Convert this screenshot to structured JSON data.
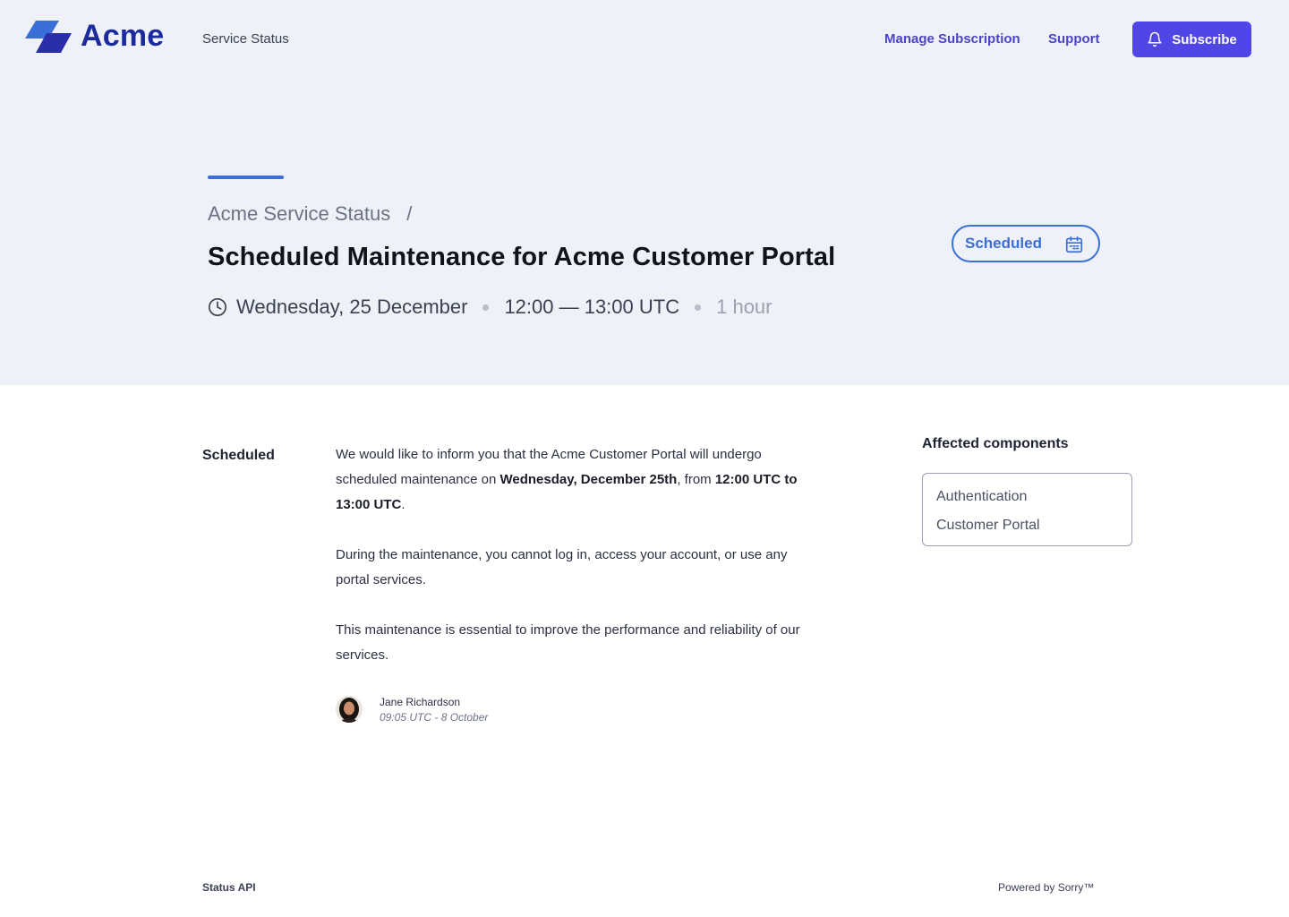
{
  "header": {
    "brand": "Acme",
    "service_status": "Service Status",
    "nav": {
      "manage_subscription": "Manage Subscription",
      "support": "Support",
      "subscribe": "Subscribe"
    }
  },
  "incident": {
    "breadcrumb_root": "Acme Service Status",
    "breadcrumb_separator": "/",
    "title": "Scheduled Maintenance for Acme Customer Portal",
    "date": "Wednesday, 25 December",
    "time_range": "12:00 — 13:00 UTC",
    "duration": "1 hour",
    "status": "Scheduled"
  },
  "update": {
    "label": "Scheduled",
    "paragraph1": {
      "intro": "We would like to inform you that the Acme Customer Portal will undergo scheduled maintenance on ",
      "date_bold": "Wednesday, December 25th",
      "middle": ", from ",
      "time_bold": "12:00 UTC to 13:00 UTC",
      "end": "."
    },
    "paragraph2": "During the maintenance, you cannot log in, access your account, or use any portal services.",
    "paragraph3": "This maintenance is essential to improve the performance and reliability of our services.",
    "author": {
      "name": "Jane Richardson",
      "timestamp": "09:05 UTC - 8 October"
    }
  },
  "affected": {
    "title": "Affected components",
    "components": [
      "Authentication",
      "Customer Portal"
    ]
  },
  "footer": {
    "status_api": "Status API",
    "powered_by": "Powered by Sorry™"
  },
  "colors": {
    "brand": "#1b2a9c",
    "accent": "#4f46e5",
    "status_blue": "#3b6fd8",
    "hero_bg": "#eef1f7"
  }
}
